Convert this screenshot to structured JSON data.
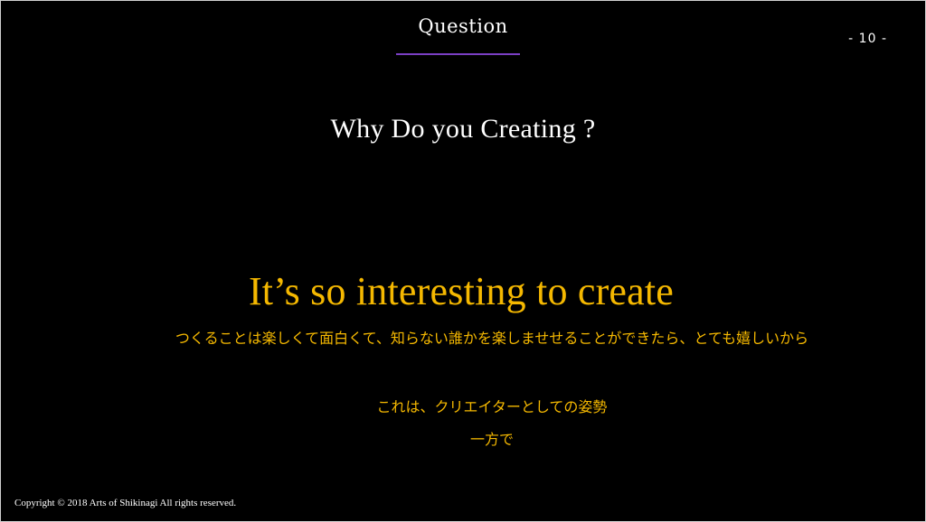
{
  "slide": {
    "header": "Question",
    "page_number": "- 10 -",
    "question": "Why Do you Creating ?",
    "answer": "It’s so interesting to create",
    "answer_japanese": "つくることは楽しくて面白くて、知らない誰かを楽しませせることができたら、とても嬉しいから",
    "note_line_1": "これは、クリエイターとしての姿勢",
    "note_line_2": "一方で",
    "copyright": "Copyright © 2018 Arts of Shikinagi All rights reserved."
  },
  "colors": {
    "background": "#000000",
    "accent_rule": "#7b3fc4",
    "highlight_text": "#f5b800",
    "primary_text": "#ffffff"
  }
}
